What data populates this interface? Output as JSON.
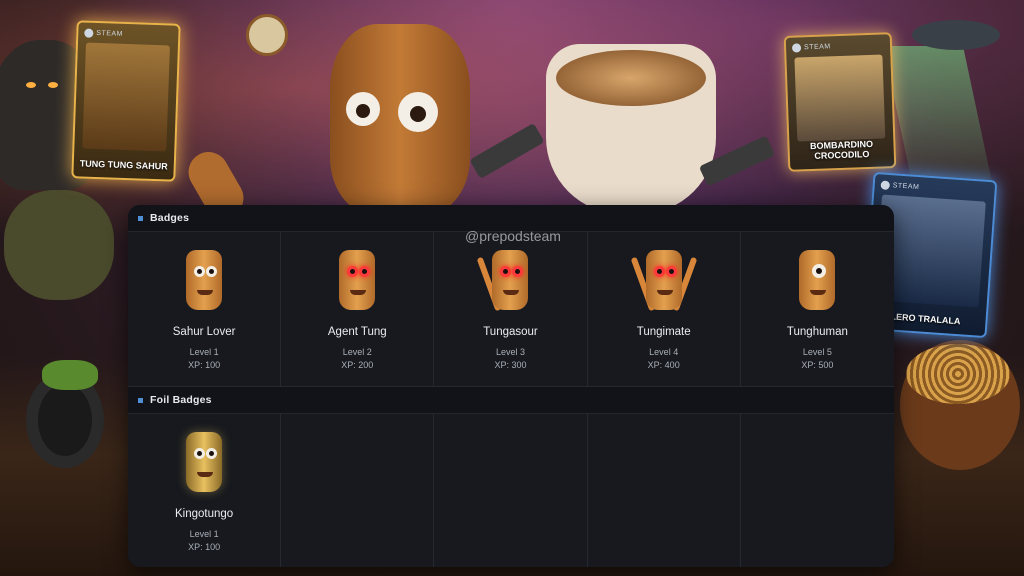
{
  "watermark": "@prepodsteam",
  "cards": [
    {
      "header": "STEAM",
      "title": "TUNG TUNG SAHUR"
    },
    {
      "header": "STEAM",
      "title": "BOMBARDINO CROCODILO"
    },
    {
      "header": "STEAM",
      "title": "LERO TRALALA"
    }
  ],
  "badges_section": {
    "title": "Badges",
    "items": [
      {
        "name": "Sahur Lover",
        "level": "Level 1",
        "xp": "XP: 100"
      },
      {
        "name": "Agent Tung",
        "level": "Level 2",
        "xp": "XP: 200"
      },
      {
        "name": "Tungasour",
        "level": "Level 3",
        "xp": "XP: 300"
      },
      {
        "name": "Tungimate",
        "level": "Level 4",
        "xp": "XP: 400"
      },
      {
        "name": "Tunghuman",
        "level": "Level 5",
        "xp": "XP: 500"
      }
    ]
  },
  "foil_section": {
    "title": "Foil Badges",
    "items": [
      {
        "name": "Kingotungo",
        "level": "Level 1",
        "xp": "XP: 100"
      }
    ]
  },
  "colors": {
    "panel_bg": "#17191e",
    "section_marker": "#4f8fd6",
    "text_primary": "#e9ecf0",
    "text_secondary": "#a9afb8"
  }
}
